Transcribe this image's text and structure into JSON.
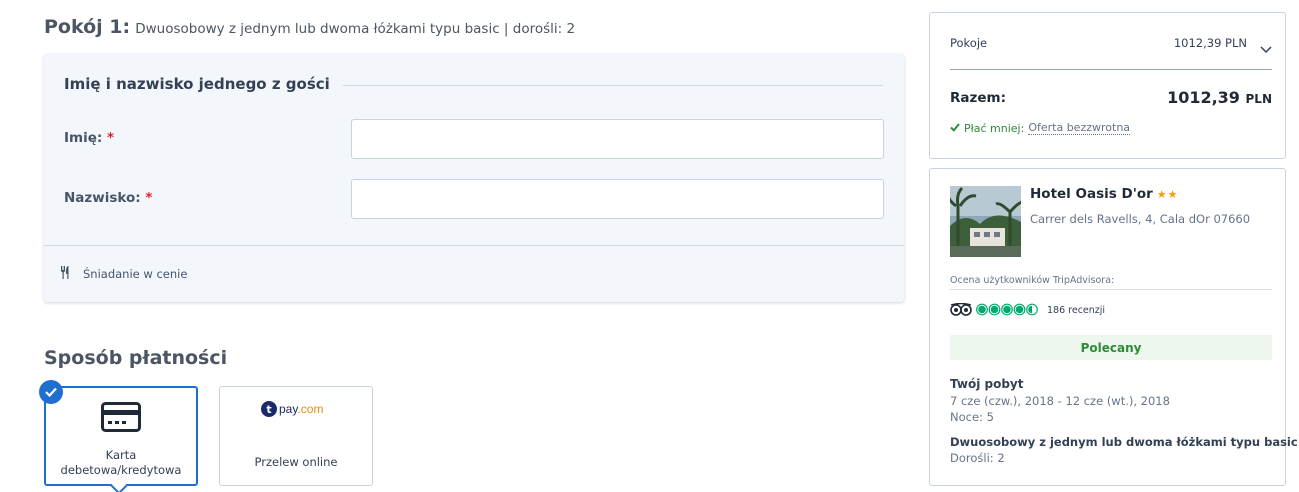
{
  "room": {
    "title": "Pokój 1:",
    "subtitle": "Dwuosobowy z jednym lub dwoma łóżkami typu basic | dorośli: 2"
  },
  "guest_form": {
    "heading": "Imię i nazwisko jednego z gości",
    "first_name_label": "Imię:",
    "last_name_label": "Nazwisko:",
    "required_mark": "*",
    "first_name_value": "",
    "last_name_value": "",
    "breakfast_label": "Śniadanie w cenie",
    "breakfast_icon": "cutlery-icon"
  },
  "payment": {
    "title": "Sposób płatności",
    "options": [
      {
        "label_line1": "Karta",
        "label_line2": "debetowa/kredytowa",
        "icon": "credit-card-icon",
        "selected": true
      },
      {
        "label": "Przelew online",
        "logo_t": "t",
        "logo_text": "pay",
        "logo_domain": ".com",
        "selected": false
      }
    ]
  },
  "summary": {
    "rooms_label": "Pokoje",
    "rooms_price": "1012,39 PLN",
    "total_label": "Razem:",
    "total_amount": "1012,39",
    "total_currency": "PLN",
    "pay_later_label": "Płać mniej:",
    "pay_later_link": "Oferta bezzwrotna"
  },
  "hotel": {
    "name": "Hotel Oasis D'or",
    "stars": "★★",
    "address": "Carrer dels Ravells, 4, Cala dOr 07660",
    "tripadvisor_label": "Ocena użytkowników TripAdvisora:",
    "rating": 4.5,
    "reviews": "186 recenzji",
    "badge": "Polecany",
    "stay_title": "Twój pobyt",
    "stay_dates": "7 cze (czw.), 2018 - 12 cze (wt.), 2018",
    "nights": "Noce: 5",
    "room_type": "Dwuosobowy z jednym lub dwoma łóżkami typu basic",
    "adults": "Dorośli: 2"
  },
  "colors": {
    "accent": "#1f6fd1",
    "success": "#2e8b3a",
    "tripadvisor": "#00aa6c",
    "star": "#f59e0b",
    "required": "#dc2626"
  }
}
